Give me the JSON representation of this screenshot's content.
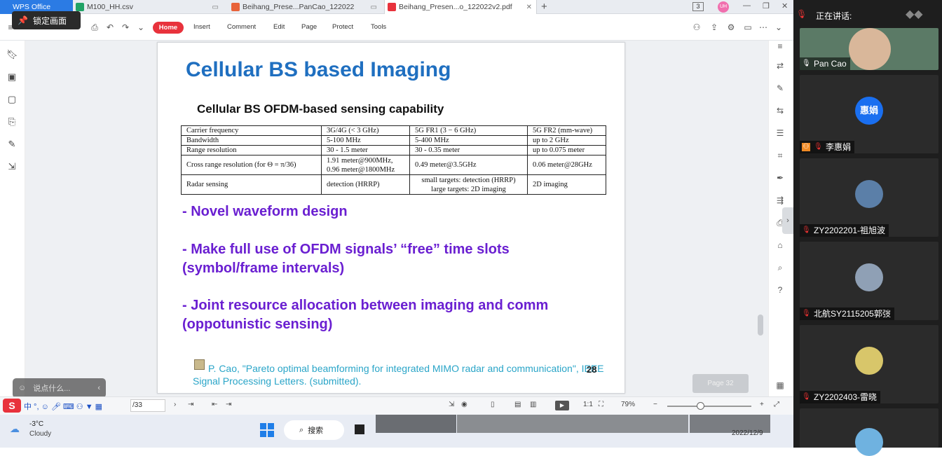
{
  "tabs": [
    {
      "label": "WPS Office",
      "icon": "wps-logo-icon",
      "color": "#2b7be4"
    },
    {
      "label": "M100_HH.csv",
      "icon": "spreadsheet-icon",
      "color": "#21a366"
    },
    {
      "label": "Beihang_Prese...PanCao_122022",
      "icon": "presentation-icon",
      "color": "#e8633a"
    },
    {
      "label": "Beihang_Presen...o_122022v2.pdf",
      "icon": "pdf-icon",
      "color": "#e8323c"
    }
  ],
  "tab_new": "+",
  "window_badge": "3",
  "user_initials": "UH",
  "ribbon": {
    "home": "Home",
    "menu": [
      "Insert",
      "Comment",
      "Edit",
      "Page",
      "Protect",
      "Tools"
    ]
  },
  "lock_screen_label": "锁定画面",
  "slide": {
    "title": "Cellular BS based Imaging",
    "subtitle": "Cellular BS OFDM-based sensing capability",
    "table": [
      [
        "Carrier frequency",
        "3G/4G (< 3 GHz)",
        "5G FR1 (3 − 6 GHz)",
        "5G FR2 (mm-wave)"
      ],
      [
        "Bandwidth",
        "5-100 MHz",
        "5-400 MHz",
        "up to 2 GHz"
      ],
      [
        "Range resolution",
        "30 - 1.5 meter",
        "30 - 0.35 meter",
        "up to 0.075 meter"
      ],
      [
        "Cross range resolution (for Θ = π/36)",
        "1.91 meter@900MHz,\n0.96 meter@1800MHz",
        "0.49 meter@3.5GHz",
        "0.06 meter@28GHz"
      ],
      [
        "Radar sensing",
        "detection (HRRP)",
        "small targets: detection (HRRP)\nlarge targets: 2D imaging",
        "2D imaging"
      ]
    ],
    "bullets": [
      "- Novel waveform design",
      "- Make full use of OFDM signals’ “free” time slots (symbol/frame intervals)",
      "- Joint resource allocation between imaging and comm (oppotunistic sensing)"
    ],
    "reference": "P. Cao, \"Pareto optimal beamforming for integrated MIMO radar and communication\", IEEE Signal Processing Letters. (submitted).",
    "page_number": "28"
  },
  "page_overlay": "Page 32",
  "chat_placeholder": "说点什么...",
  "status": {
    "page_total": "/33",
    "zoom": "79%"
  },
  "taskbar": {
    "weather_temp": "-3°C",
    "weather_desc": "Cloudy",
    "search": "搜索",
    "date": "2022/12/9"
  },
  "meeting": {
    "speaking_label": "正在讲话:",
    "participants": [
      {
        "name": "Pan Cao",
        "avatar_text": "",
        "avatar_color": "#6b8f6e",
        "video": true
      },
      {
        "name": "李惠娟",
        "avatar_text": "惠娟",
        "avatar_color": "#1a6ff0",
        "video": false
      },
      {
        "name": "ZY2202201-祖旭波",
        "avatar_text": "",
        "avatar_color": "#5b7fa8",
        "video": false
      },
      {
        "name": "北航SY2115205郭弢",
        "avatar_text": "",
        "avatar_color": "#8fa0b5",
        "video": false
      },
      {
        "name": "ZY2202403-雷晓",
        "avatar_text": "",
        "avatar_color": "#d8c66a",
        "video": false
      },
      {
        "name": "",
        "avatar_text": "",
        "avatar_color": "#6fb2e0",
        "video": false
      }
    ]
  }
}
